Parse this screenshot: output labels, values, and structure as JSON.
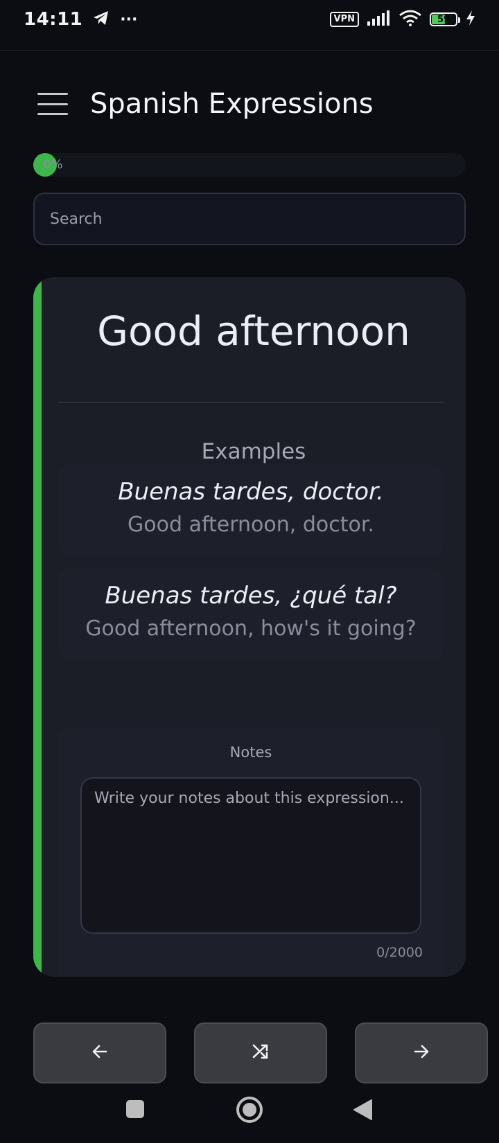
{
  "status_bar": {
    "time": "14:11",
    "more": "···",
    "vpn": "VPN",
    "battery_percent": "59",
    "battery_level": 0.59
  },
  "header": {
    "title": "Spanish Expressions"
  },
  "progress": {
    "label": "0%",
    "value": 0
  },
  "search": {
    "placeholder": "Search"
  },
  "card": {
    "title": "Good afternoon",
    "examples_heading": "Examples",
    "examples": [
      {
        "spanish": "Buenas tardes, doctor.",
        "english": "Good afternoon, doctor."
      },
      {
        "spanish": "Buenas tardes, ¿qué tal?",
        "english": "Good afternoon, how's it going?"
      }
    ],
    "notes": {
      "label": "Notes",
      "placeholder": "Write your notes about this expression...",
      "counter": "0/2000"
    }
  },
  "colors": {
    "accent": "#3db64a",
    "background": "#0c0d12",
    "card": "#1b1d27"
  },
  "navigation": {
    "prev_icon": "arrow-left-icon",
    "shuffle_icon": "shuffle-icon",
    "next_icon": "arrow-right-icon"
  }
}
